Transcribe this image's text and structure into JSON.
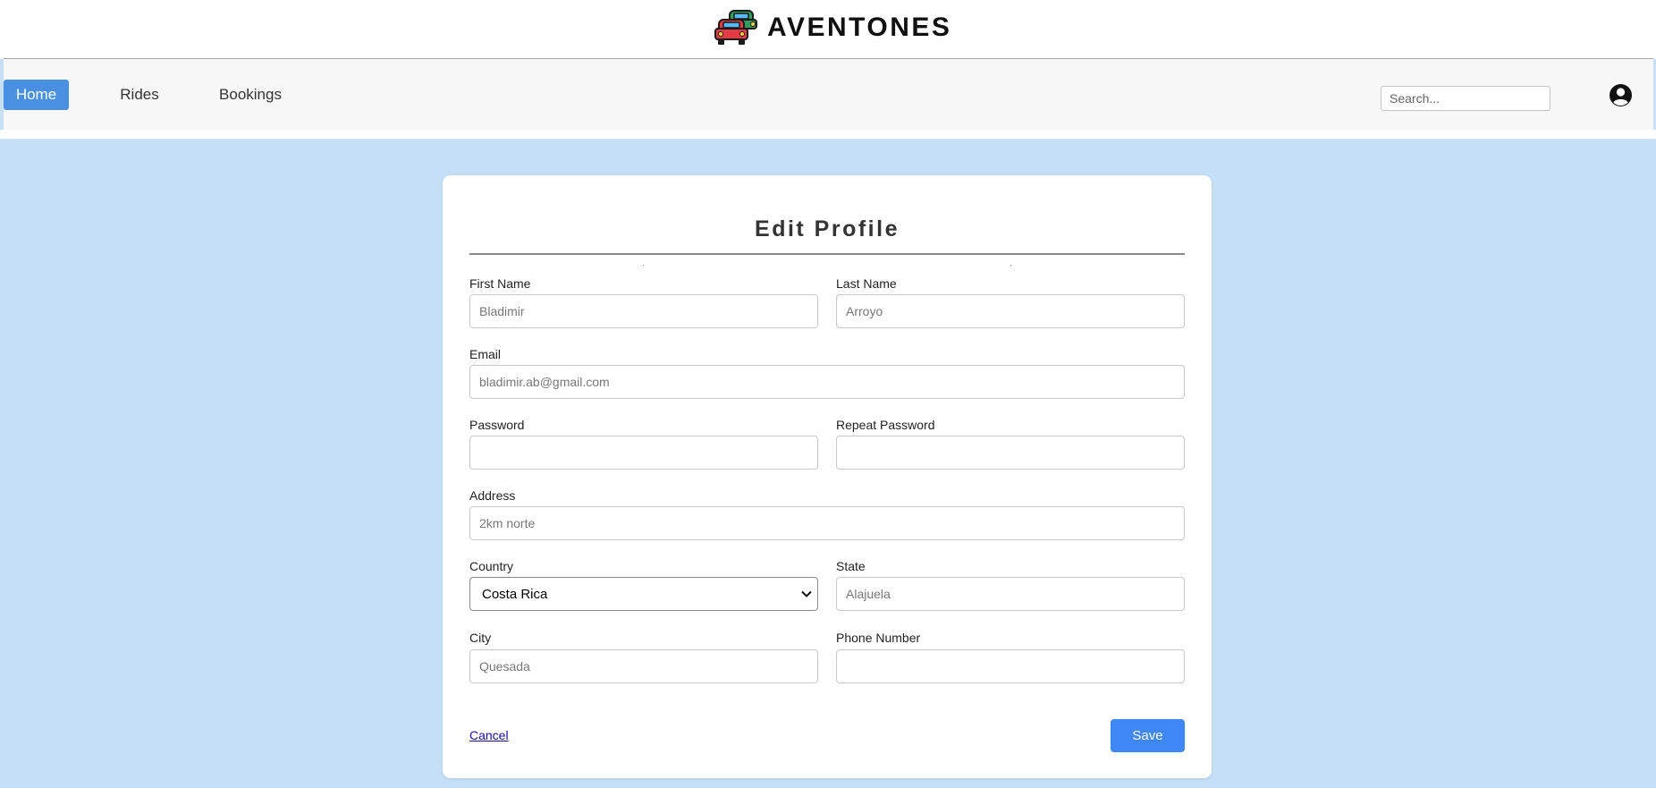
{
  "header": {
    "brand_name": "AVENTONES",
    "logo_icon": "cars-icon"
  },
  "nav": {
    "items": [
      {
        "label": "Home",
        "active": true
      },
      {
        "label": "Rides",
        "active": false
      },
      {
        "label": "Bookings",
        "active": false
      }
    ],
    "search_placeholder": "Search...",
    "user_icon": "user-circle-icon"
  },
  "form": {
    "title": "Edit Profile",
    "fields": {
      "first_name": {
        "label": "First Name",
        "placeholder": "Bladimir"
      },
      "last_name": {
        "label": "Last Name",
        "placeholder": "Arroyo"
      },
      "email": {
        "label": "Email",
        "placeholder": "bladimir.ab@gmail.com"
      },
      "password": {
        "label": "Password",
        "placeholder": ""
      },
      "repeat_password": {
        "label": "Repeat Password",
        "placeholder": ""
      },
      "address": {
        "label": "Address",
        "placeholder": "2km norte"
      },
      "country": {
        "label": "Country",
        "selected": "Costa Rica"
      },
      "state": {
        "label": "State",
        "placeholder": "Alajuela"
      },
      "city": {
        "label": "City",
        "placeholder": "Quesada"
      },
      "phone": {
        "label": "Phone Number",
        "placeholder": ""
      }
    },
    "cancel_label": "Cancel",
    "save_label": "Save"
  },
  "colors": {
    "page_background": "#c5dff6",
    "accent": "#4a90e2",
    "save_button": "#3f87f5",
    "link": "#1a0dab"
  }
}
